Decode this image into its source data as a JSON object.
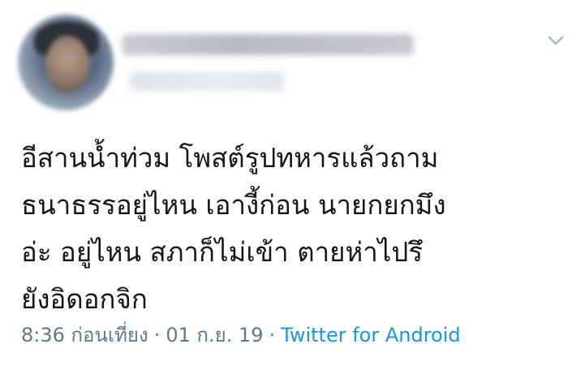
{
  "tweet": {
    "display_name": "",
    "handle": "",
    "text": "อีสานน้ำท่วม โพสต์รูปทหารแล้วถาม\nธนาธรรอยู่ไหน เอางี้ก่อน นายกยกมึง\nอ่ะ อยู่ไหน สภาก็ไม่เข้า ตายห่าไปรึ\nยังอิดอกจิก",
    "time": "8:36 ก่อนเที่ยง",
    "separator": "·",
    "date": "01 ก.ย. 19",
    "source": "Twitter for Android"
  },
  "icons": {
    "menu": "chevron-down-icon",
    "avatar": "profile-photo"
  },
  "colors": {
    "text": "#14171a",
    "meta": "#657786",
    "link": "#1b95e0",
    "chevron": "#aab8c2"
  }
}
